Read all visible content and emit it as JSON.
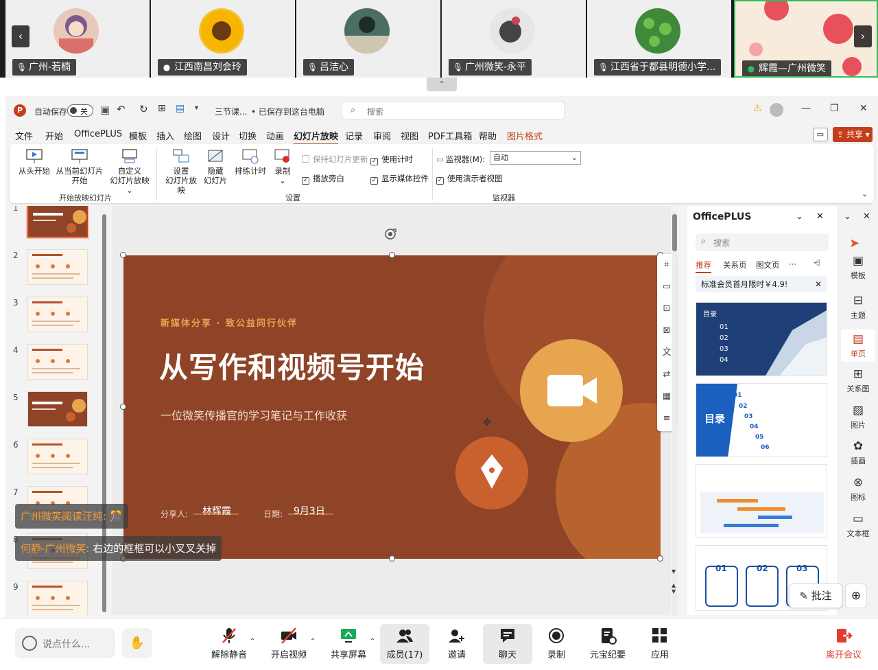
{
  "participants": [
    {
      "name": "广州-若楠",
      "mic": "muted"
    },
    {
      "name": "江西南昌刘会玲",
      "mic": "on"
    },
    {
      "name": "吕洁心",
      "mic": "muted"
    },
    {
      "name": "广州微笑-永平",
      "mic": "muted"
    },
    {
      "name": "江西省于都县明德小学...",
      "mic": "muted"
    },
    {
      "name": "辉霞—广州微笑",
      "mic": "speaking"
    }
  ],
  "titlebar": {
    "autosave_label": "自动保存",
    "autosave_state": "关",
    "filename": "三节课...",
    "save_status": "• 已保存到这台电脑",
    "search_placeholder": "搜索"
  },
  "menu": [
    "文件",
    "开始",
    "OfficePLUS",
    "模板",
    "插入",
    "绘图",
    "设计",
    "切换",
    "动画",
    "幻灯片放映",
    "记录",
    "审阅",
    "视图",
    "PDF工具箱",
    "帮助",
    "图片格式"
  ],
  "menu_active": "幻灯片放映",
  "share_label": "共享",
  "ribbon": {
    "from_start": "从头开始",
    "from_current_1": "从当前幻灯片",
    "from_current_2": "开始",
    "custom_1": "自定义",
    "custom_2": "幻灯片放映",
    "group_start": "开始放映幻灯片",
    "setup_1": "设置",
    "setup_2": "幻灯片放映",
    "hide_1": "隐藏",
    "hide_2": "幻灯片",
    "rehearse": "排练计时",
    "record": "录制",
    "keep_updated": "保持幻灯片更新",
    "play_narration": "播放旁白",
    "use_timings": "使用计时",
    "show_media": "显示媒体控件",
    "group_setup": "设置",
    "monitor_label": "监视器(M):",
    "monitor_value": "自动",
    "presenter_view": "使用演示者视图",
    "group_monitor": "监视器"
  },
  "slide_numbers": [
    "1",
    "2",
    "3",
    "4",
    "5",
    "6",
    "7",
    "8",
    "9"
  ],
  "slide": {
    "kicker": "新媒体分享 · 致公益同行伙伴",
    "title": "从写作和视频号开始",
    "subtitle": "一位微笑传播官的学习笔记与工作收获",
    "sharer_label": "分享人:",
    "sharer": "林辉霞",
    "date_label": "日期:",
    "date": "9月3日"
  },
  "officeplus": {
    "title": "OfficePLUS",
    "search_placeholder": "搜索",
    "tabs": [
      "推荐",
      "关系页",
      "图文页",
      "···"
    ],
    "banner": "标准会员首月限时￥4.9!",
    "card1_title": "目录",
    "card1_items": [
      "01",
      "02",
      "03",
      "04"
    ],
    "card2_title": "目录",
    "card2_items": [
      "01",
      "02",
      "03",
      "04",
      "05",
      "06"
    ],
    "card4_items": [
      "01",
      "02",
      "03"
    ]
  },
  "side_tools": [
    "模板",
    "主题",
    "单页",
    "关系图",
    "图片",
    "插画",
    "图标",
    "文本框"
  ],
  "side_tools_active": "单页",
  "chat": [
    {
      "sender": "广州微笑阅读汪纯:",
      "text": "🎊"
    },
    {
      "sender": "何静-广州微笑:",
      "text": "右边的框框可以小叉叉关掉"
    }
  ],
  "annotate_label": "批注",
  "bottom": {
    "say_placeholder": "说点什么...",
    "unmute": "解除静音",
    "video": "开启视频",
    "share": "共享屏幕",
    "members": "成员(17)",
    "invite": "邀请",
    "chat": "聊天",
    "record": "录制",
    "minutes": "元宝纪要",
    "apps": "应用",
    "leave": "离开会议"
  },
  "colors": {
    "accent": "#c43e1c",
    "slide_bg": "#8f4428",
    "slide_gold": "#e6a54e",
    "slide_orange": "#c9612f"
  }
}
